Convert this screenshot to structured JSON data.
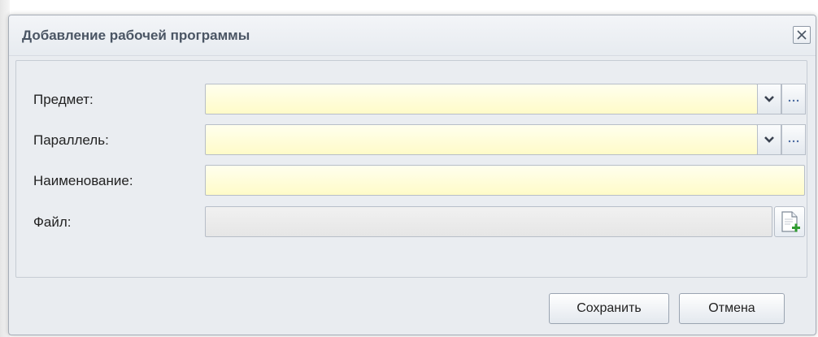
{
  "dialog": {
    "title": "Добавление рабочей программы"
  },
  "form": {
    "subject_label": "Предмет:",
    "subject_value": "",
    "parallel_label": "Параллель:",
    "parallel_value": "",
    "name_label": "Наименование:",
    "name_value": "",
    "file_label": "Файл:",
    "file_value": ""
  },
  "icons": {
    "close": "close-icon",
    "dropdown": "chevron-down-icon",
    "browse": "ellipsis-icon",
    "add_file": "add-file-icon"
  },
  "footer": {
    "save_label": "Сохранить",
    "cancel_label": "Отмена"
  },
  "colors": {
    "required_field": "#fffbc8",
    "title_text": "#4a5564",
    "add_icon": "#2f9b2f"
  }
}
